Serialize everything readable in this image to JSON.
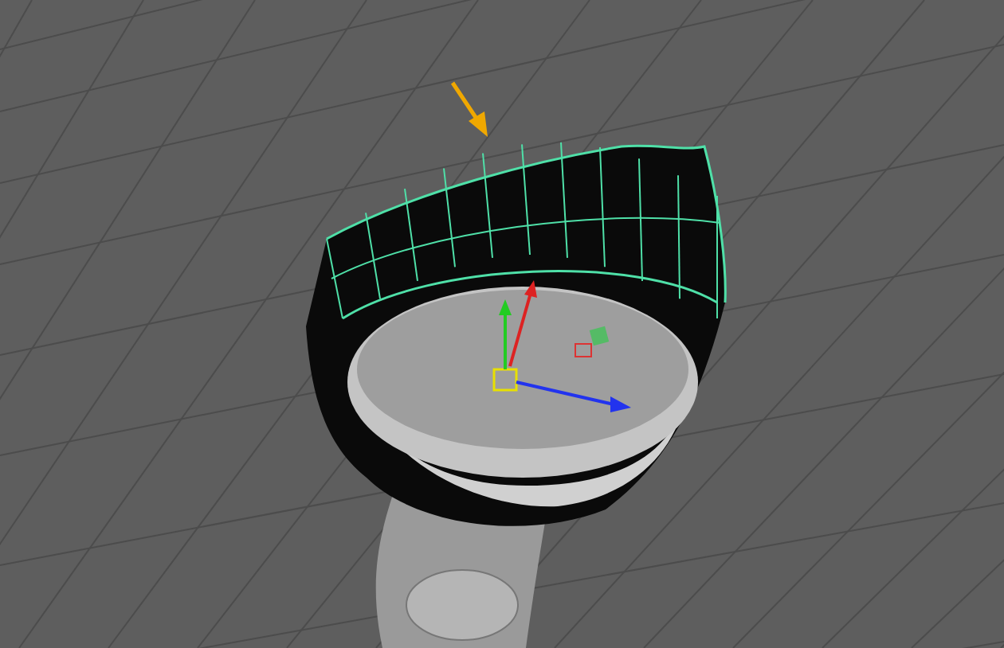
{
  "viewport": {
    "grid": true,
    "annotation_arrow": true
  }
}
